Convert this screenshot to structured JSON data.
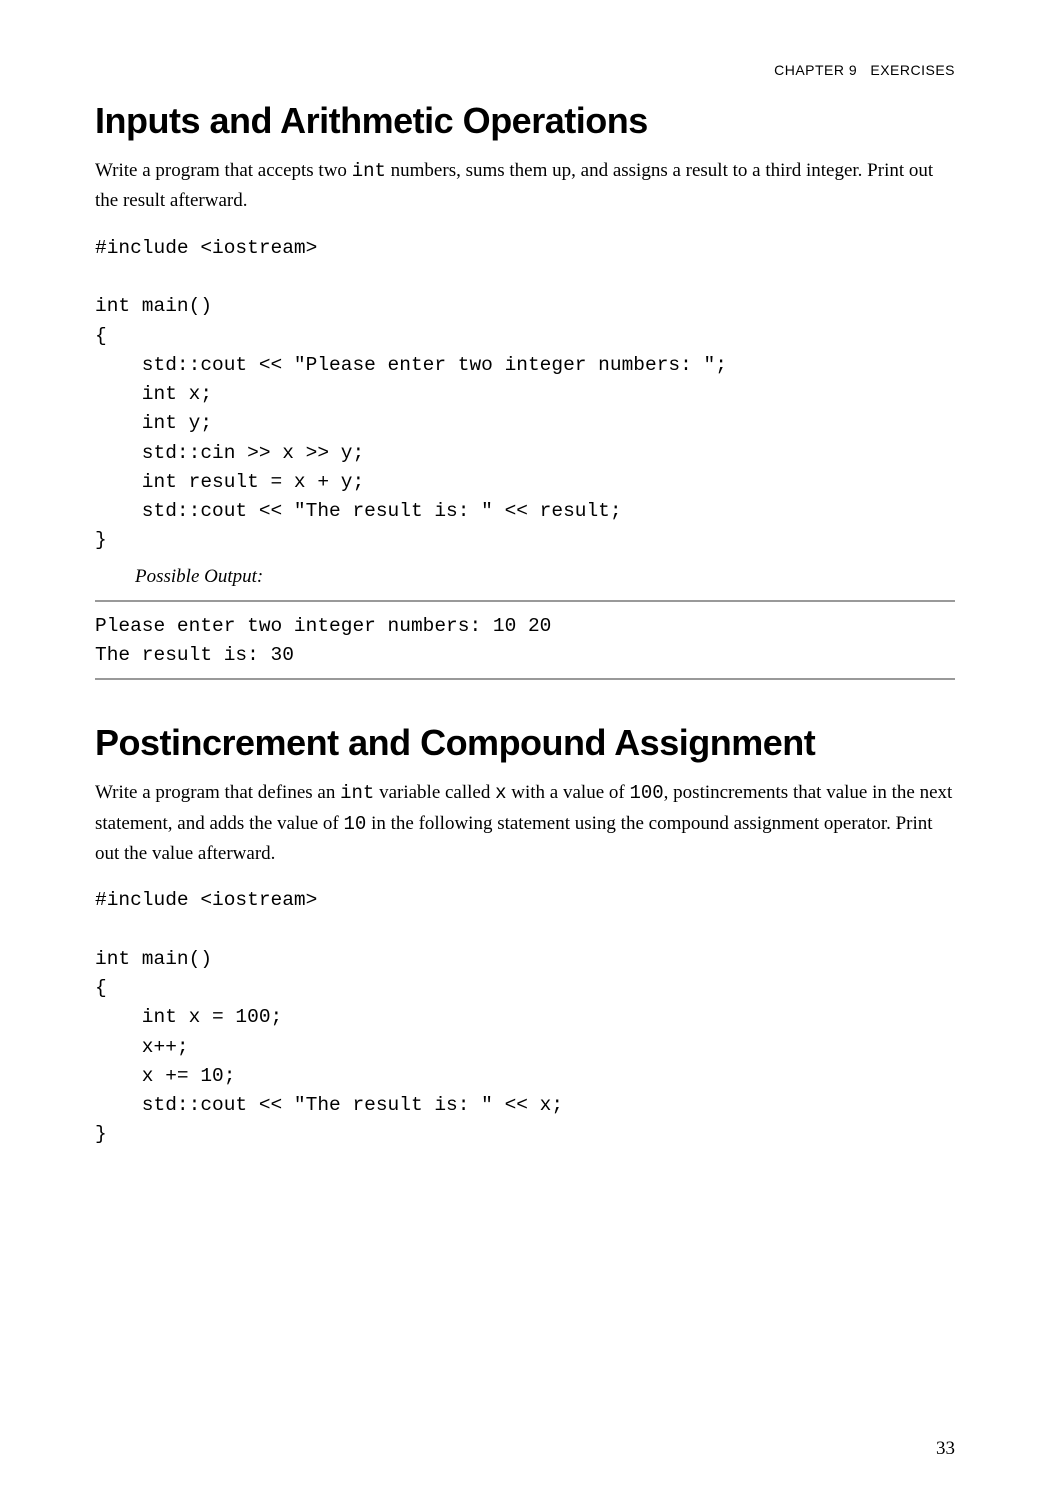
{
  "header": {
    "chapter": "CHAPTER 9",
    "title": "EXERCISES"
  },
  "sections": [
    {
      "heading": "Inputs and Arithmetic Operations",
      "body": [
        {
          "type": "text",
          "value": "Write a program that accepts two "
        },
        {
          "type": "code",
          "value": "int"
        },
        {
          "type": "text",
          "value": " numbers, sums them up, and assigns a result to a third integer. Print out the result afterward."
        }
      ],
      "code": "#include <iostream>\n\nint main()\n{\n    std::cout << \"Please enter two integer numbers: \";\n    int x;\n    int y;\n    std::cin >> x >> y;\n    int result = x + y;\n    std::cout << \"The result is: \" << result;\n}",
      "outputLabel": "Possible Output:",
      "output": "Please enter two integer numbers: 10 20\nThe result is: 30"
    },
    {
      "heading": "Postincrement and Compound Assignment",
      "body": [
        {
          "type": "text",
          "value": "Write a program that defines an "
        },
        {
          "type": "code",
          "value": "int"
        },
        {
          "type": "text",
          "value": " variable called "
        },
        {
          "type": "code",
          "value": "x"
        },
        {
          "type": "text",
          "value": " with a value of "
        },
        {
          "type": "code",
          "value": "100"
        },
        {
          "type": "text",
          "value": ", postincrements that value in the next statement, and adds the value of "
        },
        {
          "type": "code",
          "value": "10"
        },
        {
          "type": "text",
          "value": " in the following statement using the compound assignment operator. Print out the value afterward."
        }
      ],
      "code": "#include <iostream>\n\nint main()\n{\n    int x = 100;\n    x++;\n    x += 10;\n    std::cout << \"The result is: \" << x;\n}"
    }
  ],
  "pageNumber": "33"
}
